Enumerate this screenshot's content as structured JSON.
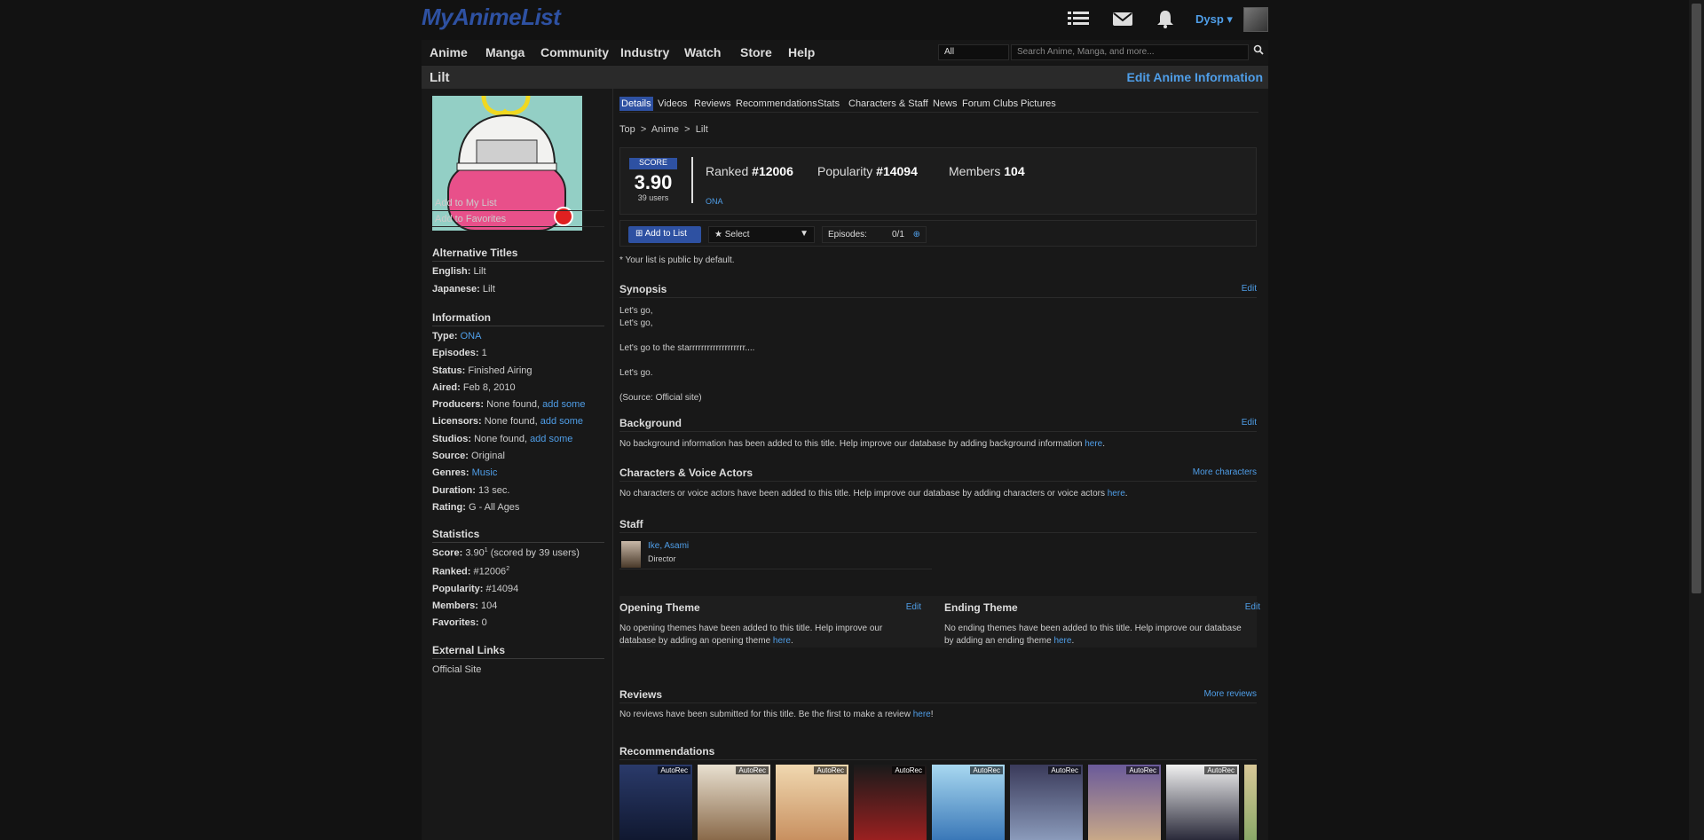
{
  "header": {
    "logo": "MyAnimeList",
    "username": "Dysp",
    "user_caret": "▾",
    "icons": [
      "list-icon",
      "mail-icon",
      "bell-icon"
    ]
  },
  "menu": {
    "items": [
      "Anime",
      "Manga",
      "Community",
      "Industry",
      "Watch",
      "Store",
      "Help"
    ],
    "search_category": "All",
    "search_placeholder": "Search Anime, Manga, and more..."
  },
  "title_bar": {
    "title": "Lilt",
    "edit_link": "Edit Anime Information"
  },
  "sidebar": {
    "add_to_list": "Add to My List",
    "add_to_favorites": "Add to Favorites",
    "alt_titles_heading": "Alternative Titles",
    "english_label": "English:",
    "english": "Lilt",
    "japanese_label": "Japanese:",
    "japanese": "Lilt",
    "info_heading": "Information",
    "info": {
      "type_label": "Type:",
      "type": "ONA",
      "episodes_label": "Episodes:",
      "episodes": "1",
      "status_label": "Status:",
      "status": "Finished Airing",
      "aired_label": "Aired:",
      "aired": "Feb 8, 2010",
      "producers_label": "Producers:",
      "producers": "None found,",
      "licensors_label": "Licensors:",
      "licensors": "None found,",
      "studios_label": "Studios:",
      "studios": "None found,",
      "add_some": "add some",
      "source_label": "Source:",
      "source": "Original",
      "genres_label": "Genres:",
      "genres": "Music",
      "duration_label": "Duration:",
      "duration": "13 sec.",
      "rating_label": "Rating:",
      "rating": "G - All Ages"
    },
    "stats_heading": "Statistics",
    "stats": {
      "score_label": "Score:",
      "score": "3.90",
      "score_sup": "1",
      "score_note": "(scored by 39 users)",
      "ranked_label": "Ranked:",
      "ranked": "#12006",
      "ranked_sup": "2",
      "popularity_label": "Popularity:",
      "popularity": "#14094",
      "members_label": "Members:",
      "members": "104",
      "favorites_label": "Favorites:",
      "favorites": "0"
    },
    "links_heading": "External Links",
    "official_site": "Official Site"
  },
  "tabs": [
    "Details",
    "Videos",
    "Reviews",
    "Recommendations",
    "Stats",
    "Characters & Staff",
    "News",
    "Forum",
    "Clubs",
    "Pictures"
  ],
  "breadcrumb": {
    "top": "Top",
    "sep": ">",
    "anime": "Anime",
    "current": "Lilt"
  },
  "scorebox": {
    "label": "SCORE",
    "value": "3.90",
    "users": "39 users",
    "ranked_label": "Ranked",
    "ranked": "#12006",
    "popularity_label": "Popularity",
    "popularity": "#14094",
    "members_label": "Members",
    "members": "104",
    "type": "ONA"
  },
  "listbar": {
    "add_button": "Add to List",
    "select": "Select",
    "episodes_label": "Episodes:",
    "episodes_value": "0/1"
  },
  "note": "* Your list is public by default.",
  "synopsis": {
    "heading": "Synopsis",
    "edit": "Edit",
    "lines": [
      "Let's go,",
      "Let's go,",
      "",
      "Let's go to the starrrrrrrrrrrrrrrrrrr....",
      "",
      "Let's go.",
      "",
      "(Source: Official site)"
    ]
  },
  "background": {
    "heading": "Background",
    "edit": "Edit",
    "text": "No background information has been added to this title. Help improve our database by adding background information",
    "link": "here",
    "end": "."
  },
  "characters": {
    "heading": "Characters & Voice Actors",
    "more": "More characters",
    "text": "No characters or voice actors have been added to this title. Help improve our database by adding characters or voice actors",
    "link": "here",
    "end": "."
  },
  "staff": {
    "heading": "Staff",
    "name": "Ike, Asami",
    "role": "Director"
  },
  "opening": {
    "heading": "Opening Theme",
    "edit": "Edit",
    "text": "No opening themes have been added to this title. Help improve our database by adding an opening theme",
    "link": "here",
    "end": "."
  },
  "ending": {
    "heading": "Ending Theme",
    "edit": "Edit",
    "text": "No ending themes have been added to this title. Help improve our database by adding an ending theme",
    "link": "here",
    "end": "."
  },
  "reviews": {
    "heading": "Reviews",
    "more": "More reviews",
    "text": "No reviews have been submitted for this title. Be the first to make a review",
    "link": "here",
    "end": "!"
  },
  "recommendations": {
    "heading": "Recommendations",
    "tag": "AutoRec",
    "colors": [
      "#2a3a6a",
      "#c9b9a0",
      "#d8b890",
      "#7a2020",
      "#6aa8d8",
      "#4a5a8a",
      "#7a6a9a",
      "#2a2a3a"
    ]
  },
  "colors": {
    "accent": "#2e51a2",
    "link": "#4f9ee8",
    "background": "#121212"
  }
}
